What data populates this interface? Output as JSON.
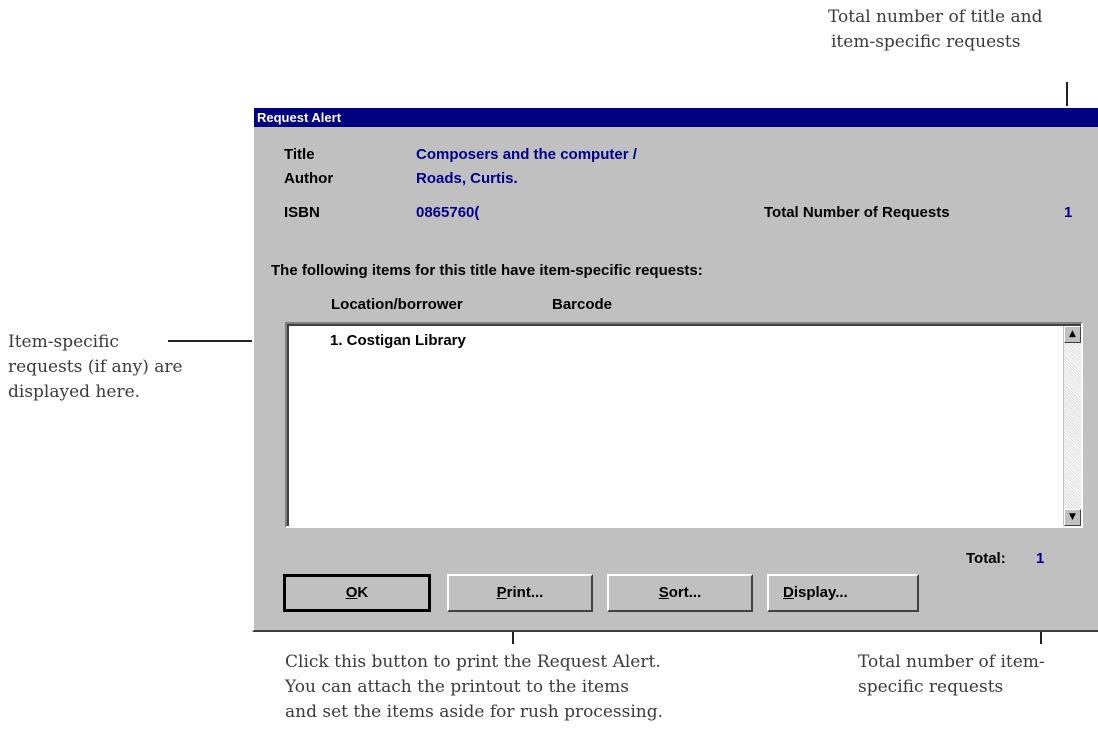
{
  "callouts": {
    "top_right_1": "Total number of title and",
    "top_right_2": "item-specific requests",
    "left_1": "Item-specific",
    "left_2": "requests (if any) are",
    "left_3": "displayed here.",
    "bottom_mid_1": "Click this button to print the Request Alert.",
    "bottom_mid_2": "You can attach the printout to the items",
    "bottom_mid_3": "and set the items aside for rush processing.",
    "bottom_right_1": "Total number of item-",
    "bottom_right_2": "specific requests"
  },
  "dialog": {
    "title": "Request Alert",
    "fields": {
      "title_label": "Title",
      "title_value": "Composers and the computer /",
      "author_label": "Author",
      "author_value": "Roads, Curtis.",
      "isbn_label": "ISBN",
      "isbn_value": "0865760(",
      "total_requests_label": "Total Number of Requests",
      "total_requests_value": "1"
    },
    "items_heading": "The following items for this title have item-specific requests:",
    "columns": {
      "location": "Location/borrower",
      "barcode": "Barcode"
    },
    "list_items": [
      "1. Costigan Library"
    ],
    "total_label": "Total:",
    "total_value": "1",
    "buttons": {
      "ok": {
        "label": "OK",
        "mnemonic": "O",
        "rest": "K"
      },
      "print": {
        "label": "Print...",
        "mnemonic": "P",
        "rest": "rint..."
      },
      "sort": {
        "label": "Sort...",
        "mnemonic": "S",
        "rest": "ort..."
      },
      "display": {
        "label": "Display...",
        "mnemonic": "D",
        "rest": "isplay..."
      }
    }
  }
}
